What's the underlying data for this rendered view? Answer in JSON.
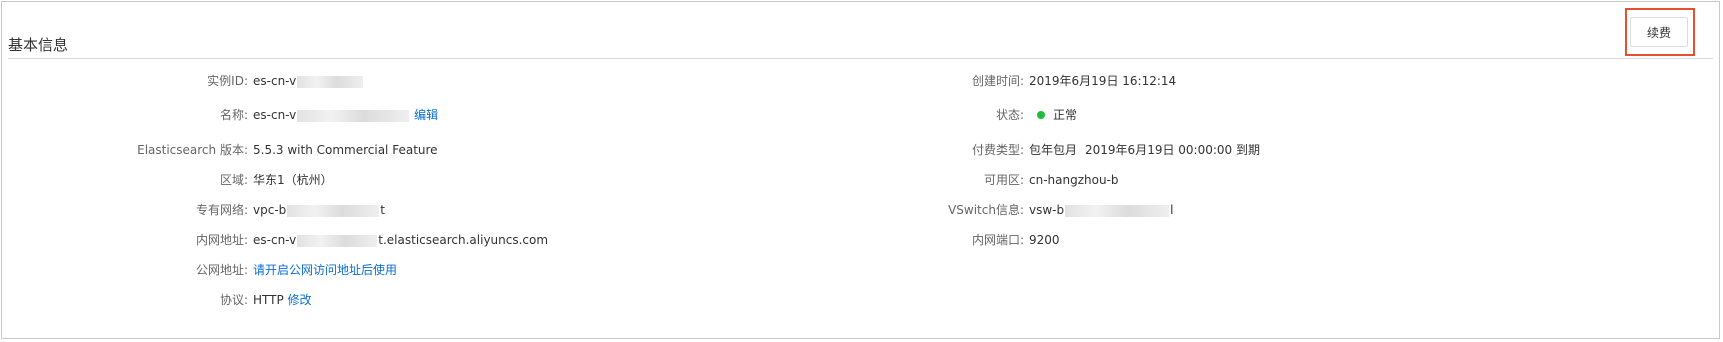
{
  "section": {
    "title": "基本信息",
    "renew_button": "续费"
  },
  "colors": {
    "link": "#0a6fd6",
    "status_ok": "#1dbf3a",
    "highlight_border": "#e2522f"
  },
  "left": {
    "instance_id": {
      "label": "实例ID:",
      "value_visible": "es-cn-v"
    },
    "name": {
      "label": "名称:",
      "value_visible": "es-cn-v",
      "edit_link": "编辑"
    },
    "version": {
      "label": "Elasticsearch 版本:",
      "value": "5.5.3 with Commercial Feature"
    },
    "region": {
      "label": "区域:",
      "value": "华东1（杭州）"
    },
    "vpc": {
      "label": "专有网络:",
      "value_prefix": "vpc-b",
      "value_suffix": "t"
    },
    "private_address": {
      "label": "内网地址:",
      "value_prefix": "es-cn-v",
      "value_suffix": "t.elasticsearch.aliyuncs.com"
    },
    "public_address": {
      "label": "公网地址:",
      "link": "请开启公网访问地址后使用"
    },
    "protocol": {
      "label": "协议:",
      "value": "HTTP",
      "edit_link": "修改"
    }
  },
  "right": {
    "created_time": {
      "label": "创建时间:",
      "value": "2019年6月19日 16:12:14"
    },
    "status": {
      "label": "状态:",
      "value": "正常"
    },
    "billing": {
      "label": "付费类型:",
      "type": "包年包月",
      "expire": "2019年6月19日 00:00:00 到期"
    },
    "zone": {
      "label": "可用区:",
      "value": "cn-hangzhou-b"
    },
    "vswitch": {
      "label": "VSwitch信息:",
      "value_prefix": "vsw-b",
      "value_suffix": "l"
    },
    "private_port": {
      "label": "内网端口:",
      "value": "9200"
    }
  }
}
